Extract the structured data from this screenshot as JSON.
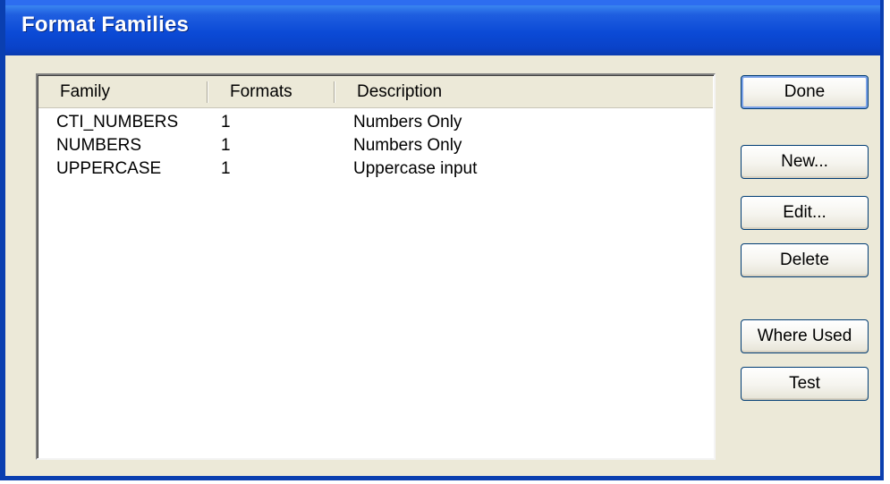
{
  "window": {
    "title": "Format Families"
  },
  "list": {
    "columns": [
      "Family",
      "Formats",
      "Description"
    ],
    "rows": [
      {
        "family": "CTI_NUMBERS",
        "formats": "1",
        "description": "Numbers Only"
      },
      {
        "family": "NUMBERS",
        "formats": "1",
        "description": "Numbers Only"
      },
      {
        "family": "UPPERCASE",
        "formats": "1",
        "description": "Uppercase input"
      }
    ]
  },
  "buttons": {
    "done": "Done",
    "new": "New...",
    "edit": "Edit...",
    "delete": "Delete",
    "where_used": "Where Used",
    "test": "Test"
  }
}
